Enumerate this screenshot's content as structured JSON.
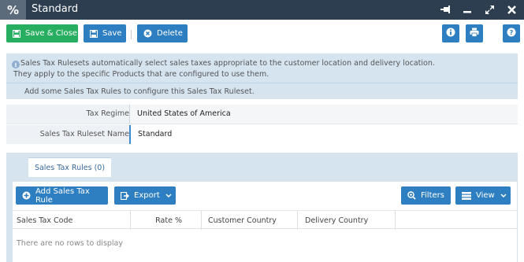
{
  "window": {
    "app_icon": "%",
    "title": "Standard"
  },
  "toolbar": {
    "save_close": "Save & Close",
    "save": "Save",
    "delete": "Delete"
  },
  "info": {
    "line1": "Sales Tax Rulesets automatically select sales taxes appropriate to the customer location and delivery location.",
    "line2": "They apply to the specific Products that are configured to use them.",
    "line3": "Add some Sales Tax Rules to configure this Sales Tax Ruleset."
  },
  "form": {
    "tax_regime_label": "Tax Regime",
    "tax_regime_value": "United States of America",
    "ruleset_name_label": "Sales Tax Ruleset Name",
    "ruleset_name_value": "Standard"
  },
  "tabs": [
    {
      "label": "Sales Tax Rules (0)"
    }
  ],
  "grid": {
    "add_button": "Add Sales Tax Rule",
    "export_button": "Export",
    "filters_button": "Filters",
    "view_button": "View",
    "columns": [
      "Sales Tax Code",
      "Rate %",
      "Customer Country",
      "Delivery Country"
    ],
    "empty_message": "There are no rows to display"
  },
  "colors": {
    "titlebar": "#2c3e50",
    "accent_green": "#27ae60",
    "accent_blue": "#2e7fc1",
    "panel": "#d6e4f0"
  }
}
